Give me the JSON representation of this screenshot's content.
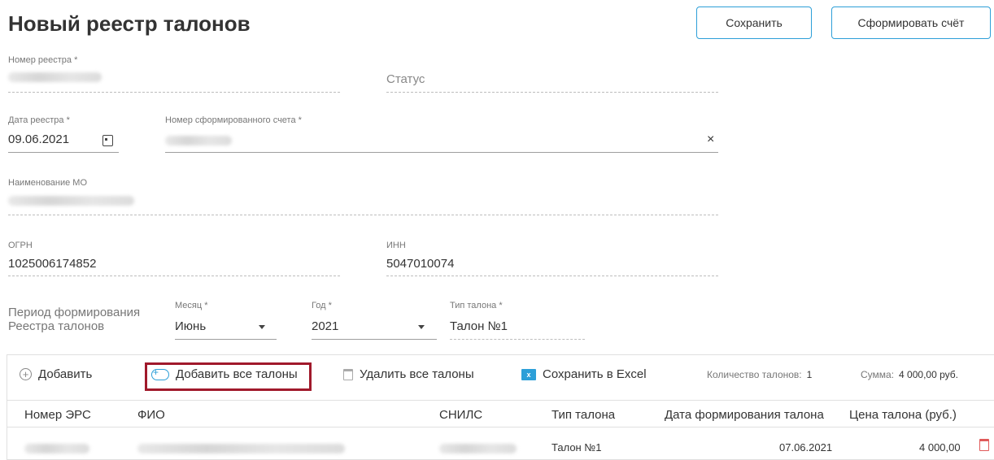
{
  "header": {
    "title": "Новый реестр талонов",
    "save_label": "Сохранить",
    "invoice_label": "Сформировать счёт"
  },
  "form": {
    "registry_number_label": "Номер реестра *",
    "status_placeholder": "Статус",
    "registry_date_label": "Дата реестра *",
    "registry_date_value": "09.06.2021",
    "invoice_number_label": "Номер сформированного счета *",
    "clear_symbol": "×",
    "mo_name_label": "Наименование МО",
    "ogrn_label": "ОГРН",
    "ogrn_value": "1025006174852",
    "inn_label": "ИНН",
    "inn_value": "5047010074",
    "period_label": "Период формирования Реестра талонов",
    "month_label": "Месяц *",
    "month_value": "Июнь",
    "year_label": "Год *",
    "year_value": "2021",
    "coupon_type_label": "Тип талона *",
    "coupon_type_value": "Талон №1"
  },
  "toolbar": {
    "add_label": "Добавить",
    "add_all_label": "Добавить все талоны",
    "delete_all_label": "Удалить все талоны",
    "excel_label": "Сохранить в Excel",
    "excel_icon_text": "x",
    "count_label": "Количество талонов:",
    "count_value": "1",
    "sum_label": "Сумма:",
    "sum_value": "4 000,00 руб."
  },
  "table": {
    "headers": [
      "Номер ЭРС",
      "ФИО",
      "СНИЛС",
      "Тип талона",
      "Дата формирования талона",
      "Цена талона (руб.)"
    ],
    "rows": [
      {
        "type": "Талон №1",
        "date": "07.06.2021",
        "price": "4 000,00"
      }
    ]
  },
  "colors": {
    "accent": "#2d9fd8",
    "highlight_border": "#a0192b",
    "delete_icon": "#e05a5a"
  }
}
